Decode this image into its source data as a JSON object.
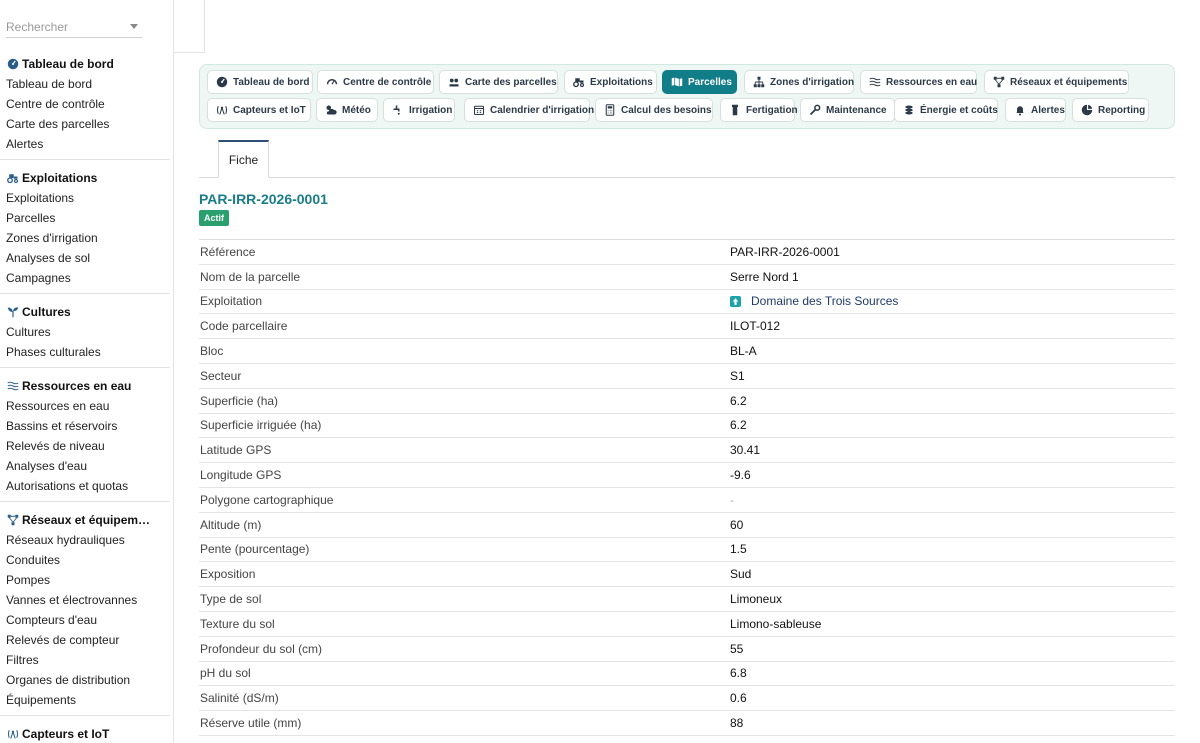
{
  "search": {
    "placeholder": "Rechercher"
  },
  "sidebar": {
    "sections": [
      {
        "title": "Tableau de bord",
        "icon": "dashboard-icon",
        "items": [
          "Tableau de bord",
          "Centre de contrôle",
          "Carte des parcelles",
          "Alertes"
        ]
      },
      {
        "title": "Exploitations",
        "icon": "tractor-icon",
        "items": [
          "Exploitations",
          "Parcelles",
          "Zones d'irrigation",
          "Analyses de sol",
          "Campagnes"
        ]
      },
      {
        "title": "Cultures",
        "icon": "sprout-icon",
        "items": [
          "Cultures",
          "Phases culturales"
        ]
      },
      {
        "title": "Ressources en eau",
        "icon": "water-icon",
        "items": [
          "Ressources en eau",
          "Bassins et réservoirs",
          "Relevés de niveau",
          "Analyses d'eau",
          "Autorisations et quotas"
        ]
      },
      {
        "title": "Réseaux et équipem…",
        "icon": "network-icon",
        "items": [
          "Réseaux hydrauliques",
          "Conduites",
          "Pompes",
          "Vannes et électrovannes",
          "Compteurs d'eau",
          "Relevés de compteur",
          "Filtres",
          "Organes de distribution",
          "Équipements"
        ]
      },
      {
        "title": "Capteurs et IoT",
        "icon": "antenna-icon",
        "items": []
      }
    ]
  },
  "nav": {
    "row1": [
      {
        "label": "Tableau de bord",
        "icon": "dashboard-icon"
      },
      {
        "label": "Centre de contrôle",
        "icon": "gauge-icon"
      },
      {
        "label": "Carte des parcelles",
        "icon": "map-pins-icon"
      },
      {
        "label": "Exploitations",
        "icon": "tractor-icon"
      },
      {
        "label": "Parcelles",
        "icon": "map-icon",
        "active": true
      },
      {
        "label": "Zones d'irrigation",
        "icon": "sitemap-icon"
      },
      {
        "label": "Ressources en eau",
        "icon": "water-icon"
      },
      {
        "label": "Réseaux et équipements",
        "icon": "network-icon"
      }
    ],
    "row2": [
      {
        "label": "Capteurs et IoT",
        "icon": "antenna-icon"
      },
      {
        "label": "Météo",
        "icon": "cloud-sun-icon"
      },
      {
        "label": "Irrigation",
        "icon": "faucet-icon"
      },
      {
        "label": "Calendrier d'irrigation",
        "icon": "calendar-icon"
      },
      {
        "label": "Calcul des besoins",
        "icon": "calculator-icon"
      },
      {
        "label": "Fertigation",
        "icon": "flask-icon"
      },
      {
        "label": "Maintenance",
        "icon": "wrench-icon"
      },
      {
        "label": "Énergie et coûts",
        "icon": "coins-icon"
      },
      {
        "label": "Alertes",
        "icon": "bell-icon"
      },
      {
        "label": "Reporting",
        "icon": "pie-chart-icon"
      }
    ]
  },
  "tabs": {
    "fiche": "Fiche"
  },
  "record": {
    "title": "PAR-IRR-2026-0001",
    "status": "Actif",
    "status_color": "#2aa06f",
    "fields": [
      {
        "label": "Référence",
        "value": "PAR-IRR-2026-0001"
      },
      {
        "label": "Nom de la parcelle",
        "value": "Serre Nord 1"
      },
      {
        "label": "Exploitation",
        "value": "Domaine des Trois Sources",
        "link": true
      },
      {
        "label": "Code parcellaire",
        "value": "ILOT-012"
      },
      {
        "label": "Bloc",
        "value": "BL-A"
      },
      {
        "label": "Secteur",
        "value": "S1"
      },
      {
        "label": "Superficie (ha)",
        "value": "6.2"
      },
      {
        "label": "Superficie irriguée (ha)",
        "value": "6.2"
      },
      {
        "label": "Latitude GPS",
        "value": "30.41"
      },
      {
        "label": "Longitude GPS",
        "value": "-9.6"
      },
      {
        "label": "Polygone cartographique",
        "value": "-",
        "muted": true
      },
      {
        "label": "Altitude (m)",
        "value": "60"
      },
      {
        "label": "Pente (pourcentage)",
        "value": "1.5"
      },
      {
        "label": "Exposition",
        "value": "Sud"
      },
      {
        "label": "Type de sol",
        "value": "Limoneux"
      },
      {
        "label": "Texture du sol",
        "value": "Limono-sableuse"
      },
      {
        "label": "Profondeur du sol (cm)",
        "value": "55"
      },
      {
        "label": "pH du sol",
        "value": "6.8"
      },
      {
        "label": "Salinité (dS/m)",
        "value": "0.6"
      },
      {
        "label": "Réserve utile (mm)",
        "value": "88"
      }
    ]
  },
  "colors": {
    "accent": "#117d88",
    "title": "#1a7d89",
    "link": "#1e3b6b"
  }
}
